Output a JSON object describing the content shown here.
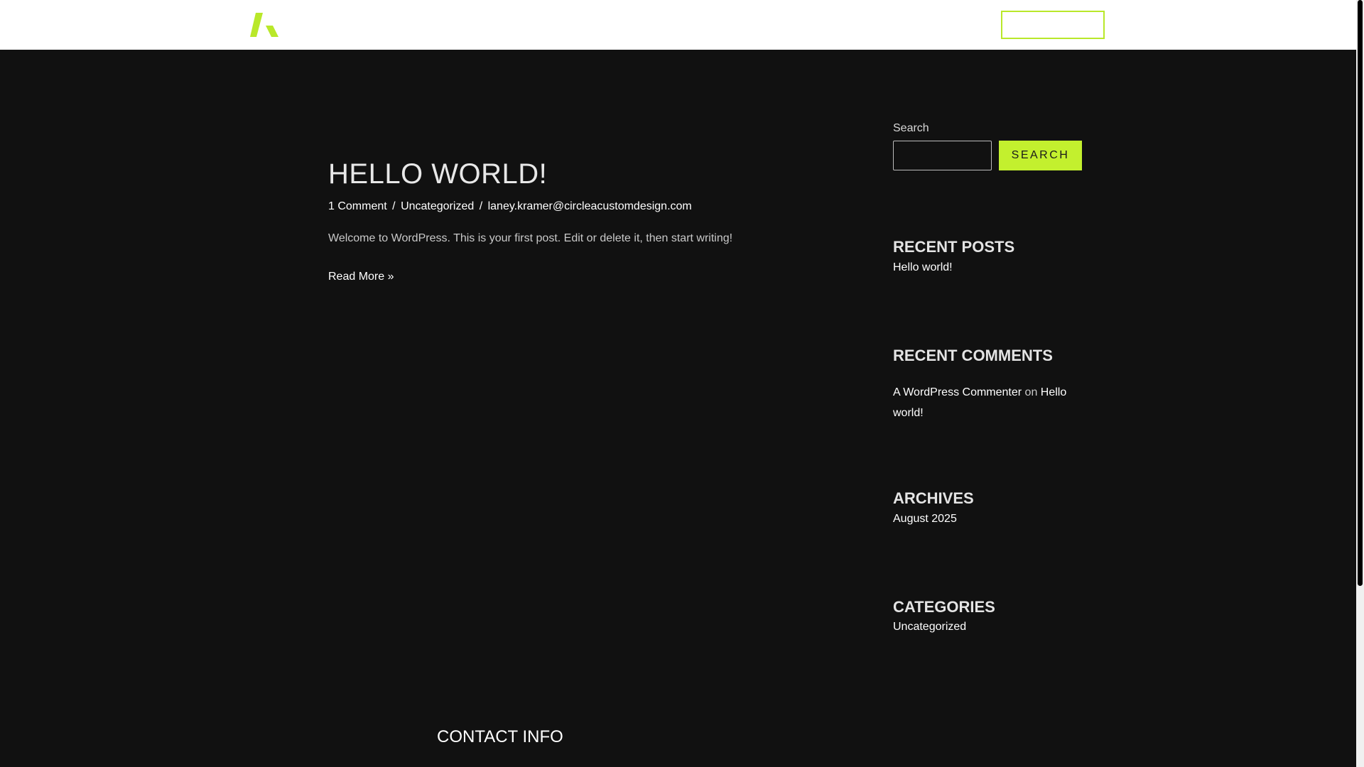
{
  "header": {
    "logo_icon": "brand-logo-icon",
    "cta_label": "",
    "accent_color": "#b9e82a"
  },
  "post": {
    "title": "HELLO WORLD!",
    "meta": {
      "comments": "1 Comment",
      "separator": "/",
      "category": "Uncategorized",
      "author": "laney.kramer@circleacustomdesign.com"
    },
    "excerpt": "Welcome to WordPress. This is your first post. Edit or delete it, then start writing!",
    "read_more": "Read More »"
  },
  "sidebar": {
    "search": {
      "label": "Search",
      "placeholder": "",
      "value": "",
      "button_label": "SEARCH"
    },
    "recent_posts": {
      "title": "RECENT POSTS",
      "items": [
        "Hello world!"
      ]
    },
    "recent_comments": {
      "title": "RECENT COMMENTS",
      "author": "A WordPress Commenter",
      "connector": "on",
      "post": "Hello world!"
    },
    "archives": {
      "title": "ARCHIVES",
      "items": [
        "August 2025"
      ]
    },
    "categories": {
      "title": "CATEGORIES",
      "items": [
        "Uncategorized"
      ]
    }
  },
  "footer": {
    "contact_title": "CONTACT INFO"
  },
  "colors": {
    "background": "#111111",
    "header_background": "#ffffff",
    "accent": "#c3f02e"
  }
}
